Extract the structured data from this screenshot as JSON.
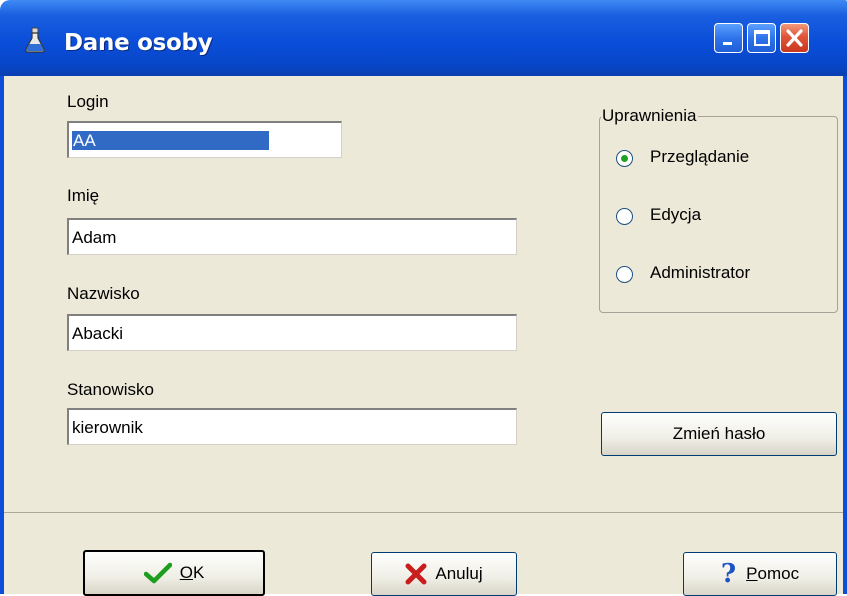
{
  "window": {
    "title": "Dane osoby"
  },
  "form": {
    "login_label": "Login",
    "login_value": "AA",
    "first_name_label": "Imię",
    "first_name_value": "Adam",
    "last_name_label": "Nazwisko",
    "last_name_value": "Abacki",
    "position_label": "Stanowisko",
    "position_value": "kierownik"
  },
  "permissions": {
    "title": "Uprawnienia",
    "options": [
      {
        "label": "Przeglądanie",
        "selected": true
      },
      {
        "label": "Edycja",
        "selected": false
      },
      {
        "label": "Administrator",
        "selected": false
      }
    ]
  },
  "buttons": {
    "change_password": "Zmień hasło",
    "ok_underlined": "O",
    "ok_rest": "K",
    "cancel": "Anuluj",
    "help_underlined": "P",
    "help_rest": "omoc"
  },
  "colors": {
    "titlebar": "#0a4ed9",
    "face": "#ece9d8",
    "selection": "#316ac5",
    "close": "#e0553a"
  }
}
